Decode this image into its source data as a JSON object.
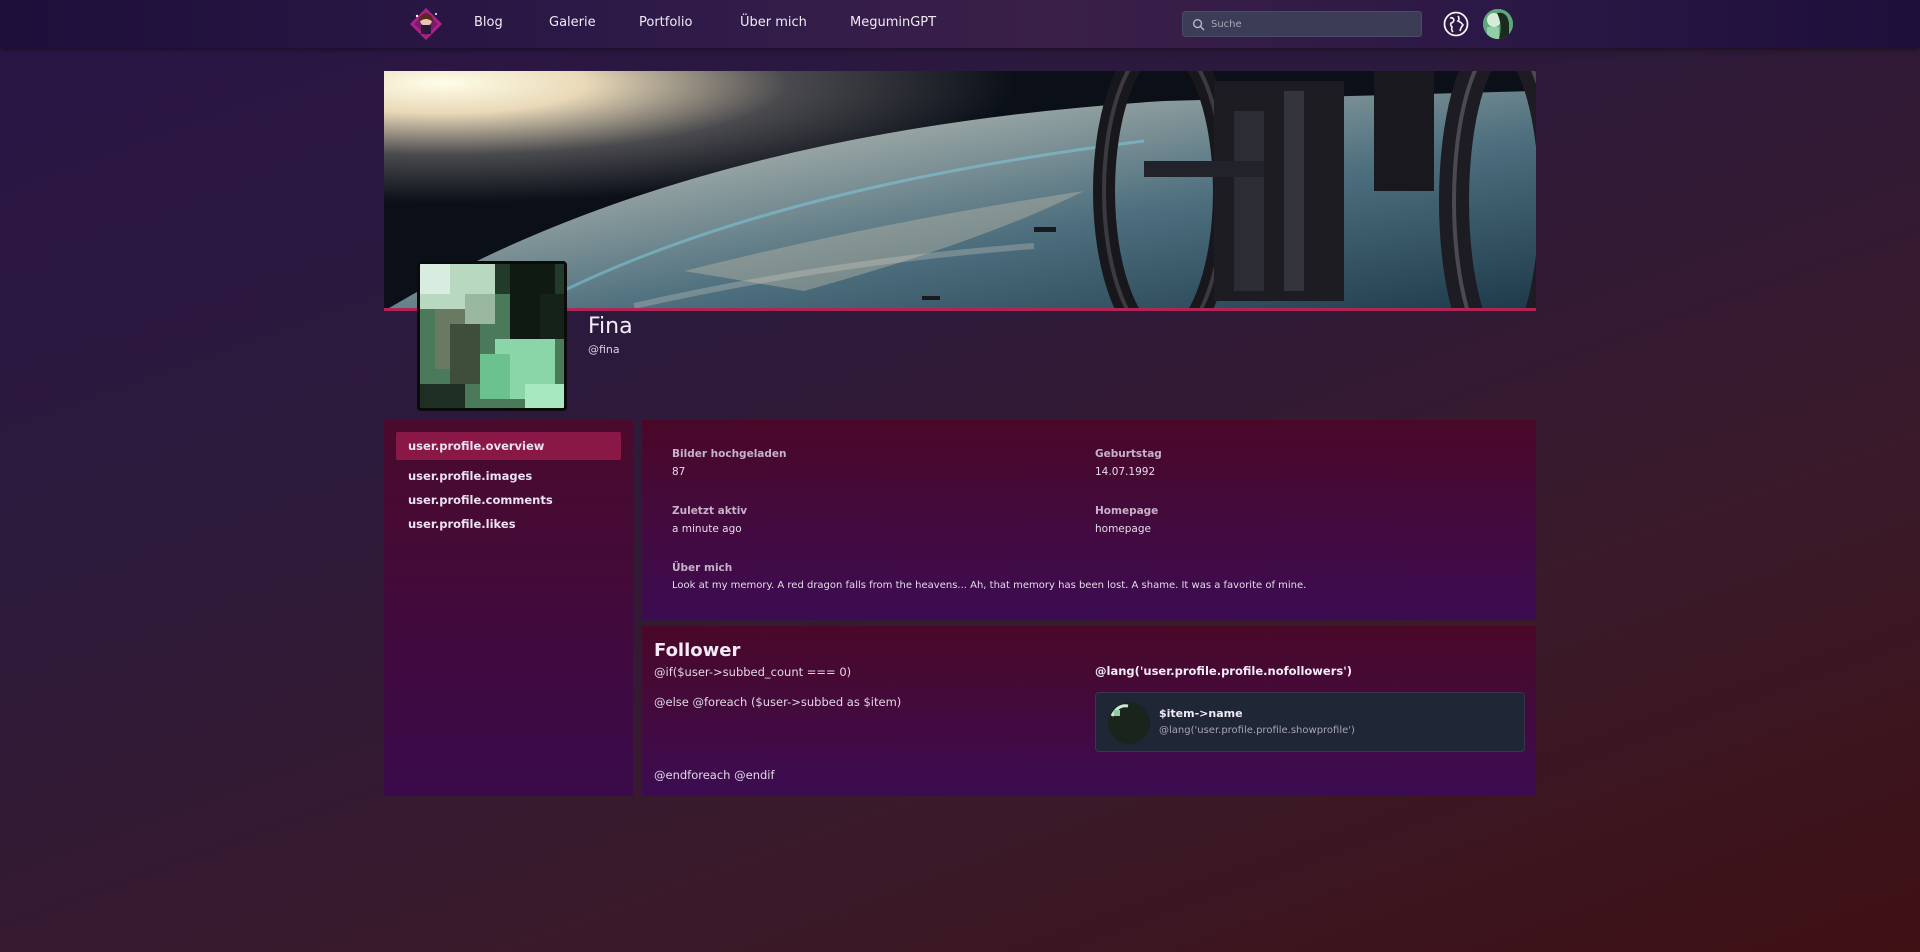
{
  "nav": {
    "links": [
      "Blog",
      "Galerie",
      "Portfolio",
      "Über mich",
      "MeguminGPT"
    ],
    "search_placeholder": "Suche"
  },
  "profile": {
    "name": "Fina",
    "handle": "@fina"
  },
  "sidebar": {
    "items": [
      {
        "label": "user.profile.overview",
        "active": true
      },
      {
        "label": "user.profile.images",
        "active": false
      },
      {
        "label": "user.profile.comments",
        "active": false
      },
      {
        "label": "user.profile.likes",
        "active": false
      }
    ]
  },
  "stats": {
    "images_label": "Bilder hochgeladen",
    "images_value": "87",
    "birthday_label": "Geburtstag",
    "birthday_value": "14.07.1992",
    "last_active_label": "Zuletzt aktiv",
    "last_active_value": "a minute ago",
    "homepage_label": "Homepage",
    "homepage_value": "homepage",
    "about_label": "Über mich",
    "about_value": "Look at my memory. A red dragon falls from the heavens... Ah, that memory has been lost. A shame. It was a favorite of mine."
  },
  "follower": {
    "title": "Follower",
    "line_if": "@if($user->subbed_count === 0)",
    "line_else": "@else @foreach ($user->subbed as $item)",
    "line_end": "@endforeach @endif",
    "no_followers": "@lang('user.profile.profile.nofollowers')",
    "card_name": "$item->name",
    "card_sub": "@lang('user.profile.profile.showprofile')"
  },
  "colors": {
    "accent": "#b02456",
    "active_item": "#8a1846"
  }
}
